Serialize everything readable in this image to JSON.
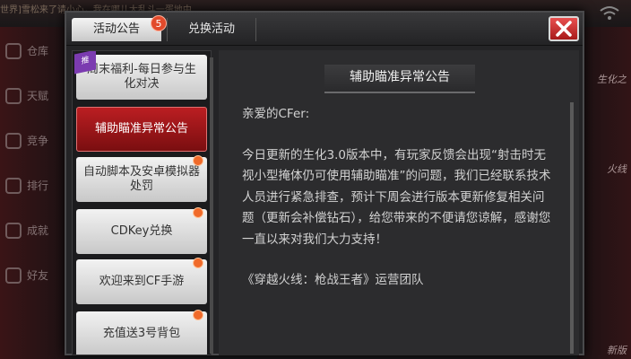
{
  "background": {
    "ticker": "世界]雪松来了请小心，我在哪儿大乱斗一蛋地中",
    "sidebar": [
      "仓库",
      "天赋",
      "竞争",
      "排行",
      "成就",
      "好友"
    ],
    "right_labels": [
      "生化之",
      "火线",
      "新版"
    ]
  },
  "tabs": {
    "active_label": "活动公告",
    "badge_count": "5",
    "other_label": "兑换活动"
  },
  "list": {
    "items": [
      {
        "label": "周末福利-每日参与生化对决",
        "ribbon": "推",
        "active": false
      },
      {
        "label": "辅助瞄准异常公告",
        "active": true
      },
      {
        "label": "自动脚本及安卓模拟器处罚",
        "active": false
      },
      {
        "label": "CDKey兑换",
        "active": false
      },
      {
        "label": "欢迎来到CF手游",
        "active": false
      },
      {
        "label": "充值送3号背包",
        "active": false
      }
    ]
  },
  "notice": {
    "title": "辅助瞄准异常公告",
    "greeting": "亲爱的CFer:",
    "body": "今日更新的生化3.0版本中，有玩家反馈会出现“射击时无视小型掩体仍可使用辅助瞄准”的问题，我们已经联系技术人员进行紧急排查，预计下周会进行版本更新修复相关问题（更新会补偿钻石），给您带来的不便请您谅解，感谢您一直以来对我们大力支持！",
    "signature": "《穿越火线：枪战王者》运营团队"
  },
  "colors": {
    "accent_red": "#bb1e22",
    "badge": "#e24a2b",
    "dot": "#f06a2a"
  }
}
